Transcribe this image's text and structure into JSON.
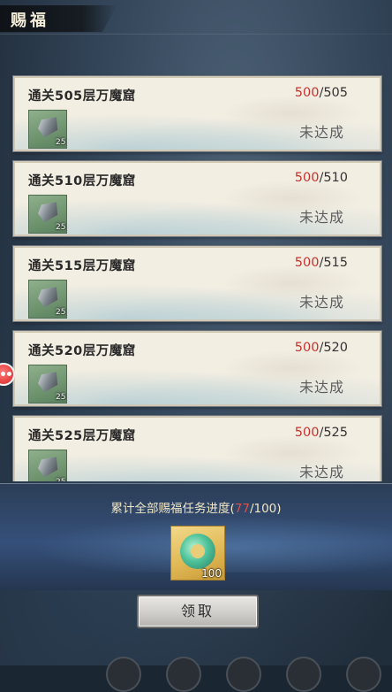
{
  "header": {
    "title": "赐福"
  },
  "tasks": [
    {
      "title": "通关505层万魔窟",
      "progress_current": "500",
      "progress_sep_total": "/505",
      "status": "未达成",
      "reward_count": "25",
      "reward_icon": "stone-icon"
    },
    {
      "title": "通关510层万魔窟",
      "progress_current": "500",
      "progress_sep_total": "/510",
      "status": "未达成",
      "reward_count": "25",
      "reward_icon": "stone-icon"
    },
    {
      "title": "通关515层万魔窟",
      "progress_current": "500",
      "progress_sep_total": "/515",
      "status": "未达成",
      "reward_count": "25",
      "reward_icon": "stone-icon"
    },
    {
      "title": "通关520层万魔窟",
      "progress_current": "500",
      "progress_sep_total": "/520",
      "status": "未达成",
      "reward_count": "25",
      "reward_icon": "stone-icon"
    },
    {
      "title": "通关525层万魔窟",
      "progress_current": "500",
      "progress_sep_total": "/525",
      "status": "未达成",
      "reward_count": "25",
      "reward_icon": "stone-icon"
    }
  ],
  "summary": {
    "label_prefix": "累计全部赐福任务进度(",
    "current": "77",
    "total_suffix": "/100)",
    "reward_count": "100",
    "reward_icon": "jade-pendant-icon"
  },
  "claim_button": {
    "label": "领取"
  },
  "colors": {
    "progress_current": "#c8322f",
    "card_bg": "#f3eee2",
    "panel_bg": "#35507a"
  }
}
